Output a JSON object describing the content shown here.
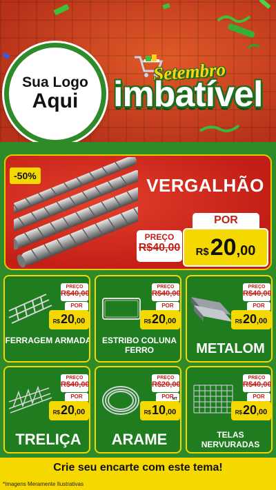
{
  "brand": {
    "logo_line1": "Sua Logo",
    "logo_line2": "Aqui",
    "promo_sub": "Setembro",
    "promo_main": "imbatível"
  },
  "featured": {
    "discount": "-50%",
    "name": "VERGALHÃO",
    "old_label": "PREÇO",
    "old_price": "R$40,00",
    "new_label": "POR",
    "currency": "R$",
    "price_int": "20",
    "price_dec": ",00",
    "illustration": "rebar-bundle"
  },
  "products": [
    {
      "name": "FERRAGEM ARMADA",
      "old_label": "PREÇO",
      "old_price": "R$40,00",
      "new_label": "POR",
      "currency": "R$",
      "price_int": "20",
      "price_dec": ",00",
      "illustration": "reinforced-steel-cage"
    },
    {
      "name": "ESTRIBO COLUNA FERRO",
      "old_label": "PREÇO",
      "old_price": "R$40,00",
      "new_label": "POR",
      "currency": "R$",
      "price_int": "20",
      "price_dec": ",00",
      "illustration": "rectangular-stirrup"
    },
    {
      "name": "METALOM",
      "old_label": "PREÇO",
      "old_price": "R$40,00",
      "new_label": "POR",
      "currency": "R$",
      "price_int": "20",
      "price_dec": ",00",
      "illustration": "metal-profile-bars"
    },
    {
      "name": "TRELIÇA",
      "old_label": "PREÇO",
      "old_price": "R$40,00",
      "new_label": "POR",
      "currency": "R$",
      "price_int": "20",
      "price_dec": ",00",
      "illustration": "lattice-truss"
    },
    {
      "name": "ARAME",
      "old_label": "PREÇO",
      "old_price": "R$20,00",
      "new_label": "POR",
      "currency": "R$",
      "price_int": "10",
      "price_dec": ",00",
      "unit": "MT",
      "illustration": "wire-coil"
    },
    {
      "name": "TELAS NERVURADAS",
      "old_label": "PREÇO",
      "old_price": "R$40,00",
      "new_label": "POR",
      "currency": "R$",
      "price_int": "20",
      "price_dec": ",00",
      "illustration": "welded-mesh"
    }
  ],
  "footer": {
    "cta": "Crie seu encarte com este tema!",
    "note": "*Imagens Meramente Ilustrativas"
  },
  "colors": {
    "brick_red": "#c8401c",
    "green": "#2f8a2a",
    "dark_green": "#1f7d20",
    "yellow": "#f5d800",
    "red": "#c41f17",
    "white": "#ffffff"
  }
}
